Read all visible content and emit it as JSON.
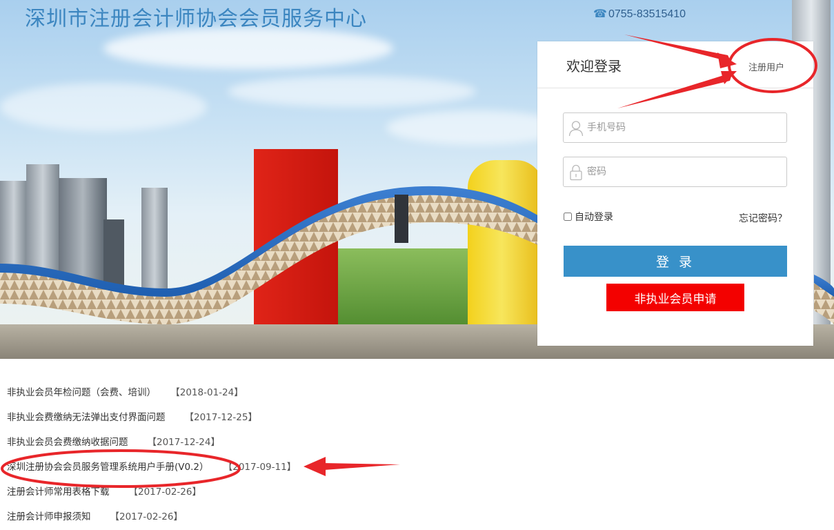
{
  "header": {
    "site_title": "深圳市注册会计师协会会员服务中心",
    "phone": "0755-83515410",
    "phone_icon": "telephone-icon"
  },
  "login": {
    "welcome": "欢迎登录",
    "register_link": "注册用户",
    "phone_placeholder": "手机号码",
    "password_placeholder": "密码",
    "remember_label": "自动登录",
    "forgot_label": "忘记密码？",
    "login_button": "登 录",
    "apply_button": "非执业会员申请",
    "colors": {
      "login_button": "#3891c9",
      "apply_button": "#f30100"
    }
  },
  "news": [
    {
      "title": "非执业会员年检问题（会费、培训）",
      "date": "【2018-01-24】"
    },
    {
      "title": "非执业会费缴纳无法弹出支付界面问题",
      "date": "【2017-12-25】"
    },
    {
      "title": "非执业会员会费缴纳收据问题",
      "date": "【2017-12-24】"
    },
    {
      "title": "深圳注册协会会员服务管理系统用户手册(V0.2）",
      "date": "【2017-09-11】"
    },
    {
      "title": "注册会计师常用表格下载",
      "date": "【2017-02-26】"
    },
    {
      "title": "注册会计师申报须知",
      "date": "【2017-02-26】"
    }
  ],
  "annotation_color": "#e8262a"
}
